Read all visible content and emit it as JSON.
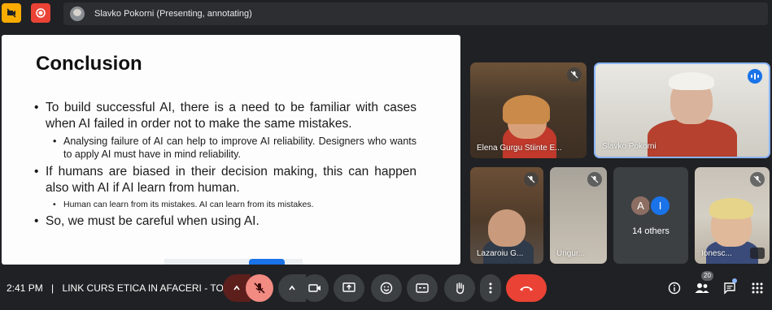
{
  "topbar": {
    "presenter_label": "Slavko Pokorni (Presenting, annotating)"
  },
  "slide": {
    "title": "Conclusion",
    "bullets": [
      {
        "text": "To build successful AI, there is a need to be familiar with cases when AI failed in order not to make the same mistakes.",
        "sub": [
          "Analysing failure of AI can help to improve AI reliability. Designers who wants to apply AI must have in mind reliability."
        ]
      },
      {
        "text": "If  humans are biased in their decision making, this can happen also with AI if AI learn from human.",
        "sub": [
          "Human can learn from its mistakes. AI can learn from its mistakes."
        ]
      },
      {
        "text": "So, we must be careful when using AI.",
        "sub": []
      }
    ]
  },
  "participants": {
    "elena": "Elena Gurgu Stiinte E...",
    "slavko": "Slavko Pokorni",
    "lazaroiu": "Lazaroiu G...",
    "ungur": "Ungur...",
    "others_avatars": [
      "A",
      "I"
    ],
    "others_label": "14 others",
    "ionesc": "Ionesc..."
  },
  "bottombar": {
    "time": "2:41 PM",
    "separator": "|",
    "meeting_title": "LINK CURS ETICA IN AFACERI - TO...",
    "people_count": "20"
  },
  "colors": {
    "record": "#ea4335",
    "warning": "#f9ab00",
    "end_call": "#ea4335",
    "speaking": "#1a73e8"
  }
}
